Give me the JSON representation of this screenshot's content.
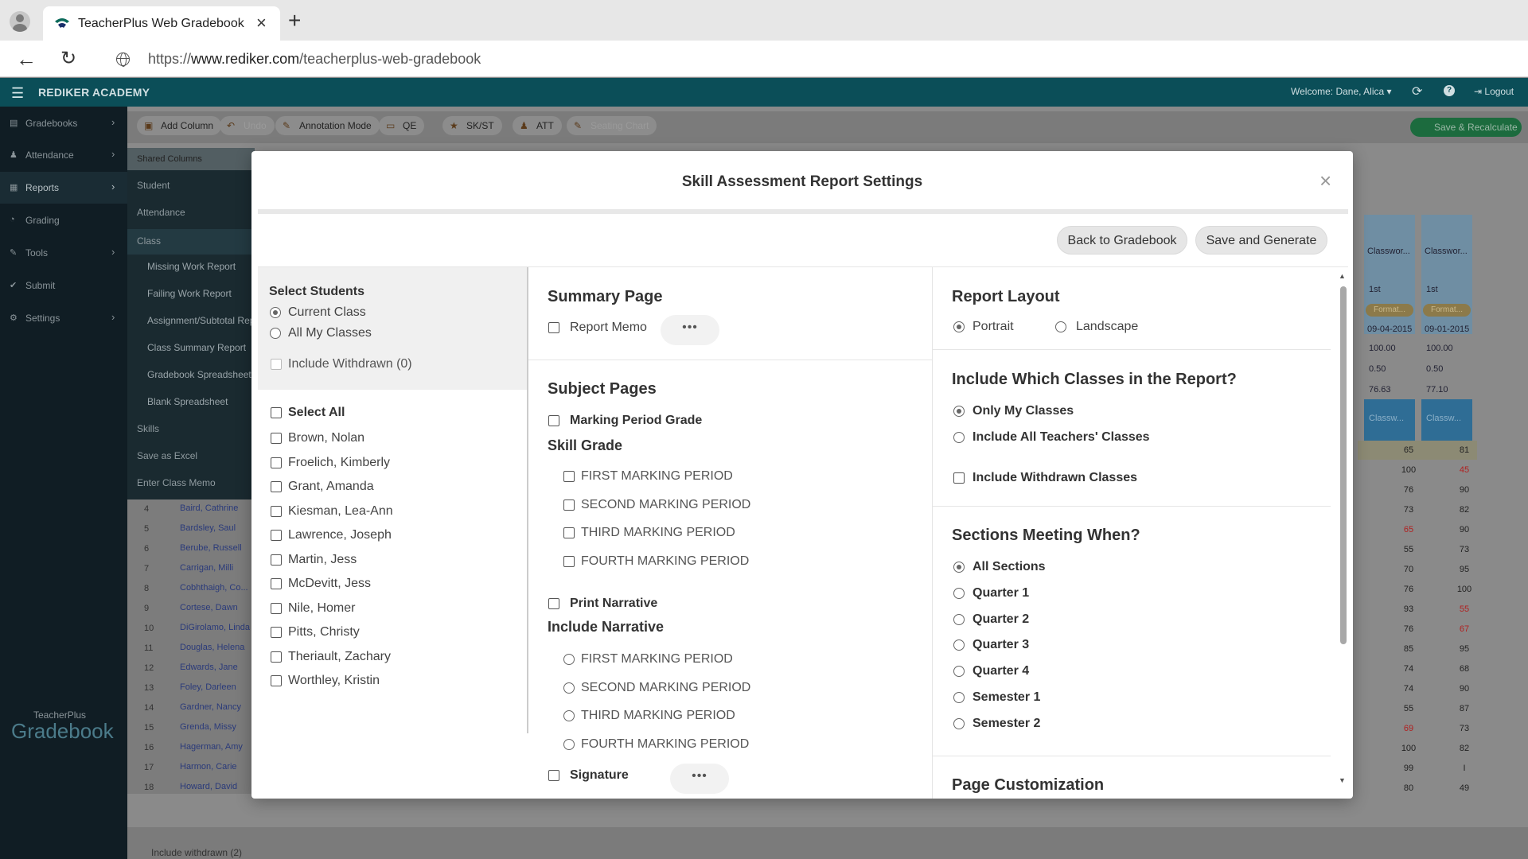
{
  "browser": {
    "tab_title": "TeacherPlus Web Gradebook - O",
    "url_host_prefix": "https://",
    "url_host": "www.rediker.com",
    "url_path": "/teacherplus-web-gradebook"
  },
  "header": {
    "school": "REDIKER ACADEMY",
    "welcome": "Welcome: Dane, Alica ▾",
    "logout": "Logout"
  },
  "sidebar": {
    "items": [
      {
        "label": "Gradebooks"
      },
      {
        "label": "Attendance"
      },
      {
        "label": "Reports"
      },
      {
        "label": "Grading"
      },
      {
        "label": "Tools"
      },
      {
        "label": "Submit"
      },
      {
        "label": "Settings"
      }
    ],
    "brand_small": "TeacherPlus",
    "brand_big": "Gradebook"
  },
  "toolbar": {
    "add_column": "Add Column",
    "undo": "Undo",
    "annotation": "Annotation Mode",
    "qe": "QE",
    "skst": "SK/ST",
    "att": "ATT",
    "seating": "Seating Chart",
    "save_recalc": "Save & Recalculate"
  },
  "reports_menu": {
    "shared_columns": "Shared Columns",
    "items": [
      {
        "label": "Student"
      },
      {
        "label": "Attendance"
      },
      {
        "label": "Class"
      },
      {
        "label": "Missing Work Report"
      },
      {
        "label": "Failing Work Report"
      },
      {
        "label": "Assignment/Subtotal Rep"
      },
      {
        "label": "Class Summary Report"
      },
      {
        "label": "Gradebook Spreadsheet"
      },
      {
        "label": "Blank Spreadsheet"
      },
      {
        "label": "Skills"
      },
      {
        "label": "Save as Excel"
      },
      {
        "label": "Enter Class Memo"
      }
    ]
  },
  "grid": {
    "rows": [
      {
        "num": "4",
        "name": "Baird, Cathrine"
      },
      {
        "num": "5",
        "name": "Bardsley, Saul"
      },
      {
        "num": "6",
        "name": "Berube, Russell"
      },
      {
        "num": "7",
        "name": "Carrigan, Milli"
      },
      {
        "num": "8",
        "name": "Cobhthaigh, Co..."
      },
      {
        "num": "9",
        "name": "Cortese, Dawn"
      },
      {
        "num": "10",
        "name": "DiGirolamo, Linda"
      },
      {
        "num": "11",
        "name": "Douglas, Helena"
      },
      {
        "num": "12",
        "name": "Edwards, Jane"
      },
      {
        "num": "13",
        "name": "Foley, Darleen"
      },
      {
        "num": "14",
        "name": "Gardner, Nancy"
      },
      {
        "num": "15",
        "name": "Grenda, Missy"
      },
      {
        "num": "16",
        "name": "Hagerman, Amy"
      },
      {
        "num": "17",
        "name": "Harmon, Carie"
      },
      {
        "num": "18",
        "name": "Howard, David"
      }
    ],
    "include_withdrawn": "Include withdrawn (2)",
    "col1": {
      "title": "Classwor...",
      "mp": "1st",
      "fmt": "Format...",
      "date": "09-04-2015",
      "max": "100.00",
      "weight": "0.50",
      "avg": "76.63",
      "blue": "Classw..."
    },
    "col2": {
      "title": "Classwor...",
      "mp": "1st",
      "fmt": "Format...",
      "date": "09-01-2015",
      "max": "100.00",
      "weight": "0.50",
      "avg": "77.10",
      "blue": "Classw..."
    },
    "col1_vals": [
      "65",
      "100",
      "76",
      "73",
      "65",
      "55",
      "70",
      "76",
      "93",
      "76",
      "85",
      "74",
      "74",
      "55",
      "69",
      "100",
      "99",
      "80"
    ],
    "col2_vals": [
      "81",
      "45",
      "90",
      "82",
      "90",
      "73",
      "95",
      "100",
      "55",
      "67",
      "95",
      "68",
      "90",
      "87",
      "73",
      "82",
      "I",
      "49"
    ]
  },
  "modal": {
    "title": "Skill Assessment Report Settings",
    "back_button": "Back to Gradebook",
    "save_button": "Save and Generate",
    "select_students": {
      "heading": "Select Students",
      "current_class": "Current Class",
      "all_my_classes": "All My Classes",
      "include_withdrawn": "Include Withdrawn (0)",
      "select_all": "Select All",
      "students": [
        "Brown, Nolan",
        "Froelich, Kimberly",
        "Grant, Amanda",
        "Kiesman, Lea-Ann",
        "Lawrence, Joseph",
        "Martin, Jess",
        "McDevitt, Jess",
        "Nile, Homer",
        "Pitts, Christy",
        "Theriault, Zachary",
        "Worthley, Kristin"
      ]
    },
    "summary": {
      "heading": "Summary Page",
      "report_memo": "Report Memo",
      "dots": "•••"
    },
    "subject": {
      "heading": "Subject Pages",
      "marking_period_grade": "Marking Period Grade",
      "skill_grade": "Skill Grade",
      "skill_periods": [
        "FIRST MARKING PERIOD",
        "SECOND MARKING PERIOD",
        "THIRD MARKING PERIOD",
        "FOURTH MARKING PERIOD"
      ],
      "print_narrative": "Print Narrative",
      "include_narrative": "Include Narrative",
      "narrative_periods": [
        "FIRST MARKING PERIOD",
        "SECOND MARKING PERIOD",
        "THIRD MARKING PERIOD",
        "FOURTH MARKING PERIOD"
      ],
      "signature": "Signature",
      "dots": "•••"
    },
    "layout": {
      "heading": "Report Layout",
      "portrait": "Portrait",
      "landscape": "Landscape"
    },
    "classes": {
      "heading": "Include Which Classes in the Report?",
      "only_my": "Only My Classes",
      "all_teachers": "Include All Teachers' Classes",
      "withdrawn": "Include Withdrawn Classes"
    },
    "sections": {
      "heading": "Sections Meeting When?",
      "options": [
        "All Sections",
        "Quarter 1",
        "Quarter 2",
        "Quarter 3",
        "Quarter 4",
        "Semester 1",
        "Semester 2"
      ]
    },
    "customization": {
      "heading": "Page Customization"
    }
  }
}
